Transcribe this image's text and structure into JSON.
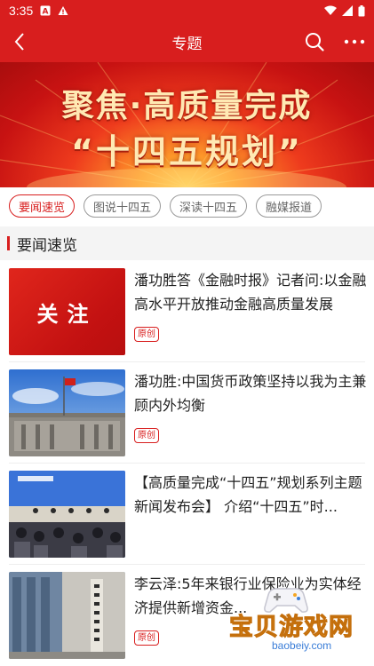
{
  "status_bar": {
    "time": "3:35"
  },
  "nav": {
    "title": "专题"
  },
  "banner": {
    "line1": "聚焦·高质量完成",
    "line2": "“十四五规划”"
  },
  "tabs": [
    {
      "label": "要闻速览"
    },
    {
      "label": "图说十四五"
    },
    {
      "label": "深读十四五"
    },
    {
      "label": "融媒报道"
    }
  ],
  "section": {
    "title": "要闻速览"
  },
  "news": [
    {
      "title": "潘功胜答《金融时报》记者问:以金融高水平开放推动金融高质量发展",
      "tag": "原创",
      "thumb_text": "关注"
    },
    {
      "title": "潘功胜:中国货币政策坚持以我为主兼顾内外均衡",
      "tag": "原创"
    },
    {
      "title": "【高质量完成“十四五”规划系列主题新闻发布会】 介绍“十四五”时...",
      "tag": ""
    },
    {
      "title": "李云泽:5年来银行业保险业为实体经济提供新增资金...",
      "tag": "原创"
    }
  ],
  "watermark": {
    "text": "宝贝游戏网",
    "url": "baobeiy.com"
  },
  "colors": {
    "brand_red": "#d81e1e",
    "tag_red": "#d81e1e"
  }
}
